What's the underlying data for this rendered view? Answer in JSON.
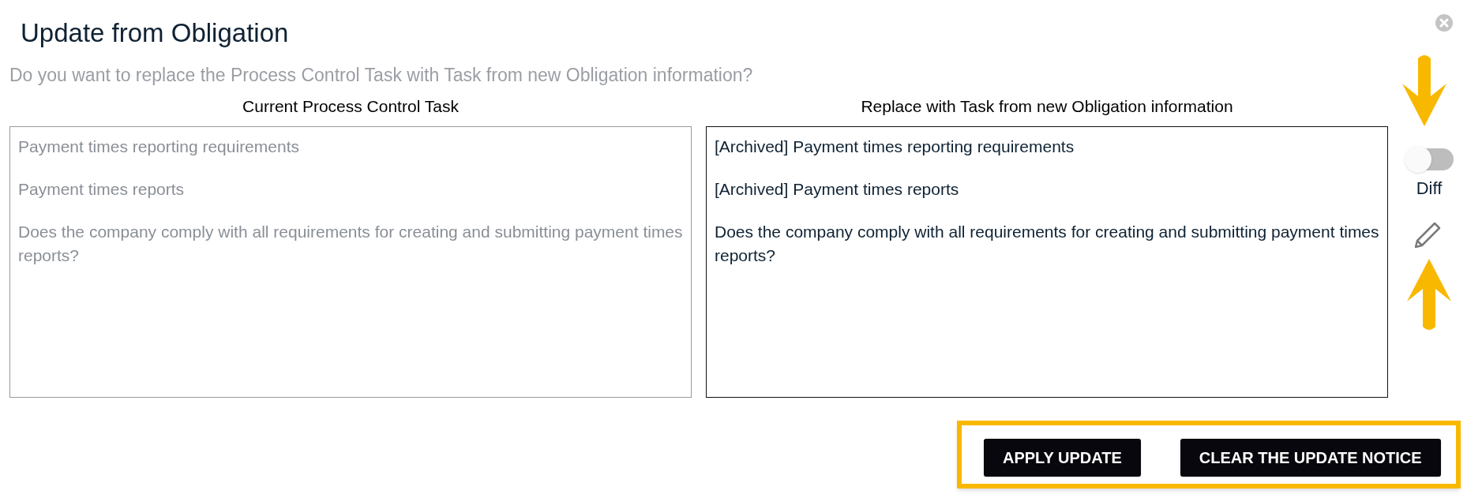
{
  "dialog": {
    "title": "Update from Obligation",
    "prompt": "Do you want to replace the Process Control Task with Task from new Obligation information?"
  },
  "columns": [
    {
      "kind": "current",
      "heading": "Current Process Control Task",
      "paragraphs": [
        "Payment times reporting requirements",
        "Payment times reports",
        "Does the company comply with all requirements for creating and submitting payment times reports?"
      ]
    },
    {
      "kind": "replacement",
      "heading": "Replace with Task from new Obligation information",
      "paragraphs": [
        "[Archived] Payment times reporting requirements",
        "[Archived] Payment times reports",
        "Does the company comply with all requirements for creating and submitting payment times reports?"
      ]
    }
  ],
  "diff_toggle": {
    "label": "Diff",
    "on": false
  },
  "buttons": [
    "APPLY UPDATE",
    "CLEAR THE UPDATE NOTICE"
  ]
}
